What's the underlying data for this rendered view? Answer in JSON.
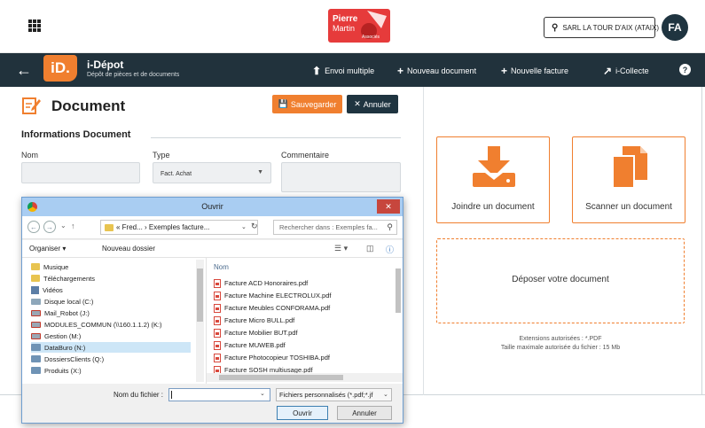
{
  "header": {
    "logo_text_line1": "Pierre",
    "logo_text_line2": "Martin",
    "logo_text_assoc": "Associés",
    "company_label": "SARL LA TOUR D'AIX (ATAIX)",
    "avatar_initials": "FA"
  },
  "navbar": {
    "app_logo": "iD.",
    "app_title": "i-Dépot",
    "app_subtitle": "Dépôt de pièces et de documents",
    "items": [
      {
        "label": "Envoi multiple",
        "icon": "upload-icon"
      },
      {
        "label": "Nouveau document",
        "icon": "plus-icon"
      },
      {
        "label": "Nouvelle facture",
        "icon": "plus-icon"
      },
      {
        "label": "i-Collecte",
        "icon": "external-link-icon"
      }
    ],
    "help": "?"
  },
  "document": {
    "title": "Document",
    "save_label": "Sauvegarder",
    "cancel_label": "Annuler",
    "section_title": "Informations Document",
    "fields": {
      "nom_label": "Nom",
      "type_label": "Type",
      "type_value": "Fact. Achat",
      "commentaire_label": "Commentaire"
    }
  },
  "right_panel": {
    "join_label": "Joindre un document",
    "scan_label": "Scanner un document",
    "drop_label": "Déposer votre document",
    "ext_line1": "Extensions autorisées : *.PDF",
    "ext_line2": "Taille maximale autorisée du fichier : 15 Mb"
  },
  "dialog": {
    "title": "Ouvrir",
    "close": "✕",
    "address_path": "« Fred... › Exemples facture...",
    "search_placeholder": "Rechercher dans : Exemples fa...",
    "organize_label": "Organiser ▾",
    "new_folder_label": "Nouveau dossier",
    "nav_items": [
      {
        "label": "Musique",
        "icon": "folder-music-icon"
      },
      {
        "label": "Téléchargements",
        "icon": "folder-download-icon"
      },
      {
        "label": "Vidéos",
        "icon": "folder-video-icon"
      },
      {
        "label": "Disque local (C:)",
        "icon": "drive-icon"
      },
      {
        "label": "Mail_Robot (J:)",
        "icon": "network-drive-icon"
      },
      {
        "label": "MODULES_COMMUN (\\\\160.1.1.2) (K:)",
        "icon": "network-drive-icon"
      },
      {
        "label": "Gestion (M:)",
        "icon": "network-drive-icon"
      },
      {
        "label": "DataBuro (N:)",
        "icon": "network-drive-icon"
      },
      {
        "label": "DossiersClients (Q:)",
        "icon": "network-drive-icon"
      },
      {
        "label": "Produits (X:)",
        "icon": "network-drive-icon"
      }
    ],
    "column_name": "Nom",
    "files": [
      "Facture ACD Honoraires.pdf",
      "Facture Machine ELECTROLUX.pdf",
      "Facture Meubles CONFORAMA.pdf",
      "Facture Micro BULL.pdf",
      "Facture Mobilier BUT.pdf",
      "Facture MUWEB.pdf",
      "Facture Photocopieur TOSHIBA.pdf",
      "Facture SOSH multiusage.pdf"
    ],
    "filename_label": "Nom du fichier :",
    "filter_value": "Fichiers personnalisés (*.pdf;*.jf",
    "open_label": "Ouvrir",
    "cancel_label": "Annuler"
  }
}
